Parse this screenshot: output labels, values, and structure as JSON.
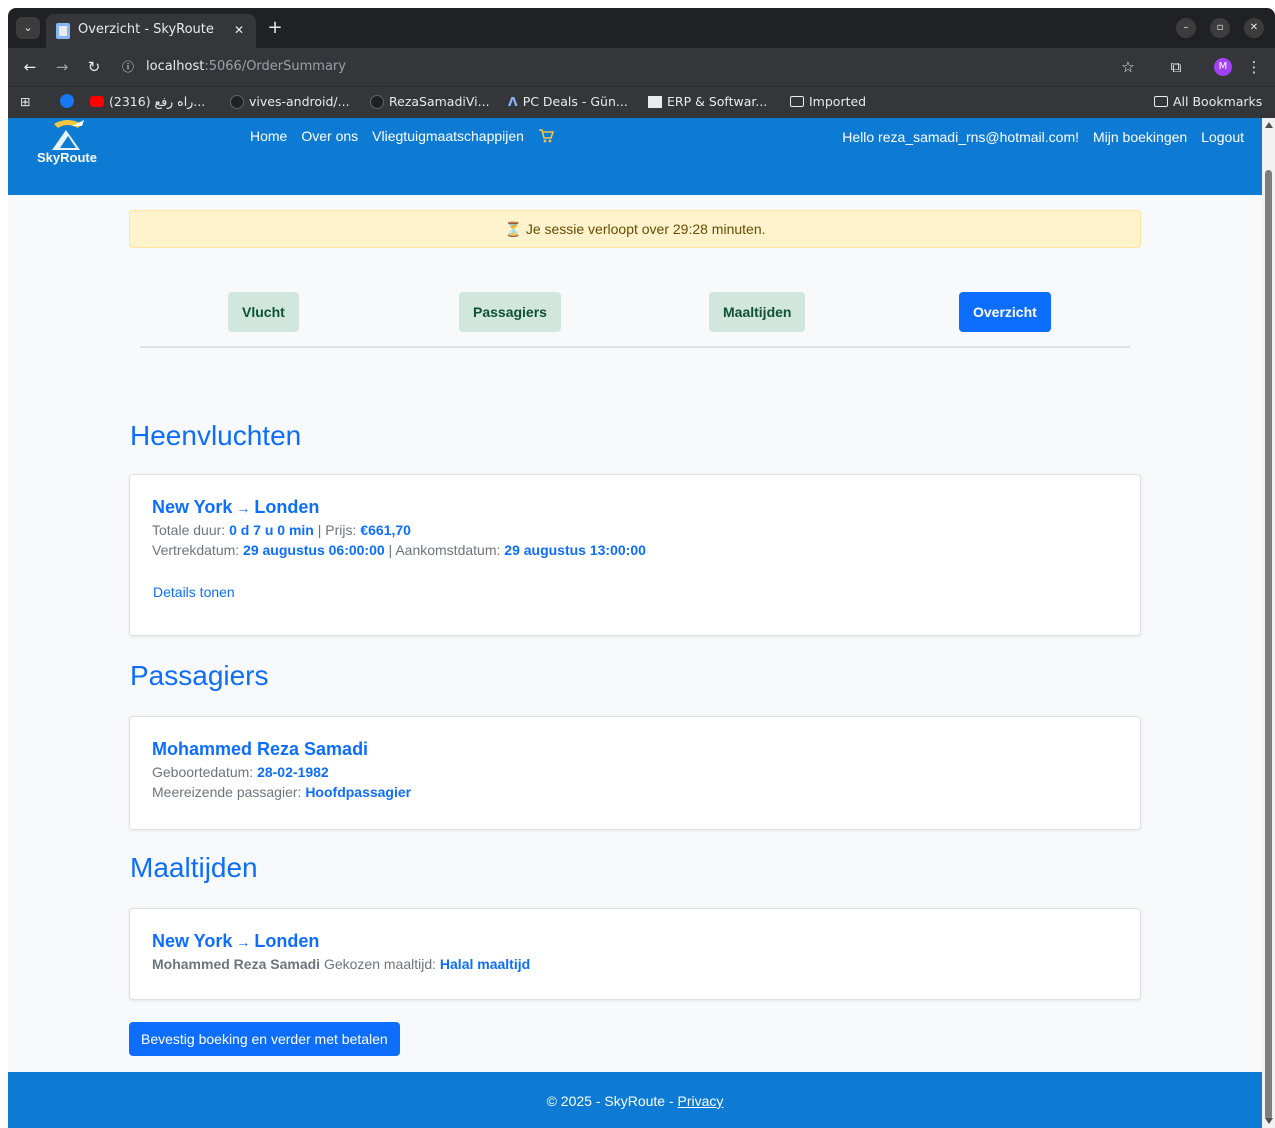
{
  "browser": {
    "tab_title": "Overzicht - SkyRoute",
    "url_host": "localhost",
    "url_path": ":5066/OrderSummary",
    "profile_initial": "M",
    "bookmarks": [
      {
        "label": "(2316) راه رفع...",
        "icon": "youtube-icon"
      },
      {
        "label": "vives-android/...",
        "icon": "github-icon"
      },
      {
        "label": "RezaSamadiVi...",
        "icon": "github-icon"
      },
      {
        "label": "PC Deals - Gün...",
        "icon": "pcdeals-icon"
      },
      {
        "label": "ERP & Softwar...",
        "icon": "erp-icon"
      },
      {
        "label": "Imported",
        "icon": "folder-icon"
      }
    ],
    "all_bookmarks": "All Bookmarks"
  },
  "site": {
    "brand": "SkyRoute",
    "nav": {
      "home": "Home",
      "about": "Over ons",
      "airlines": "Vliegtuigmaatschappijen",
      "greeting": "Hello reza_samadi_rns@hotmail.com!",
      "bookings": "Mijn boekingen",
      "logout": "Logout"
    },
    "session_alert": "Je sessie verloopt over 29:28 minuten.",
    "steps": [
      "Vlucht",
      "Passagiers",
      "Maaltijden",
      "Overzicht"
    ],
    "active_step": "Overzicht"
  },
  "flights": {
    "heading": "Heenvluchten",
    "from": "New York",
    "to": "Londen",
    "arrow": "→",
    "duration_label": "Totale duur:",
    "duration": "0 d 7 u 0 min",
    "price_label": "Prijs:",
    "price": "€661,70",
    "departure_label": "Vertrekdatum:",
    "departure": "29 augustus 06:00:00",
    "arrival_label": "Aankomstdatum:",
    "arrival": "29 augustus 13:00:00",
    "details_link": "Details tonen"
  },
  "passengers": {
    "heading": "Passagiers",
    "name": "Mohammed Reza Samadi",
    "dob_label": "Geboortedatum:",
    "dob": "28-02-1982",
    "type_label": "Meereizende passagier:",
    "type": "Hoofdpassagier"
  },
  "meals": {
    "heading": "Maaltijden",
    "from": "New York",
    "to": "Londen",
    "arrow": "→",
    "passenger": "Mohammed Reza Samadi",
    "meal_label": "Gekozen maaltijd:",
    "meal": "Halal maaltijd"
  },
  "confirm_button": "Bevestig boeking en verder met betalen",
  "footer": {
    "copyright": "© 2025 - SkyRoute -",
    "privacy": "Privacy"
  },
  "colors": {
    "nav_blue": "#0d7bd4",
    "primary": "#0d6efd",
    "alert_bg": "#fff3cd",
    "step_done_bg": "#d1e7dd"
  }
}
